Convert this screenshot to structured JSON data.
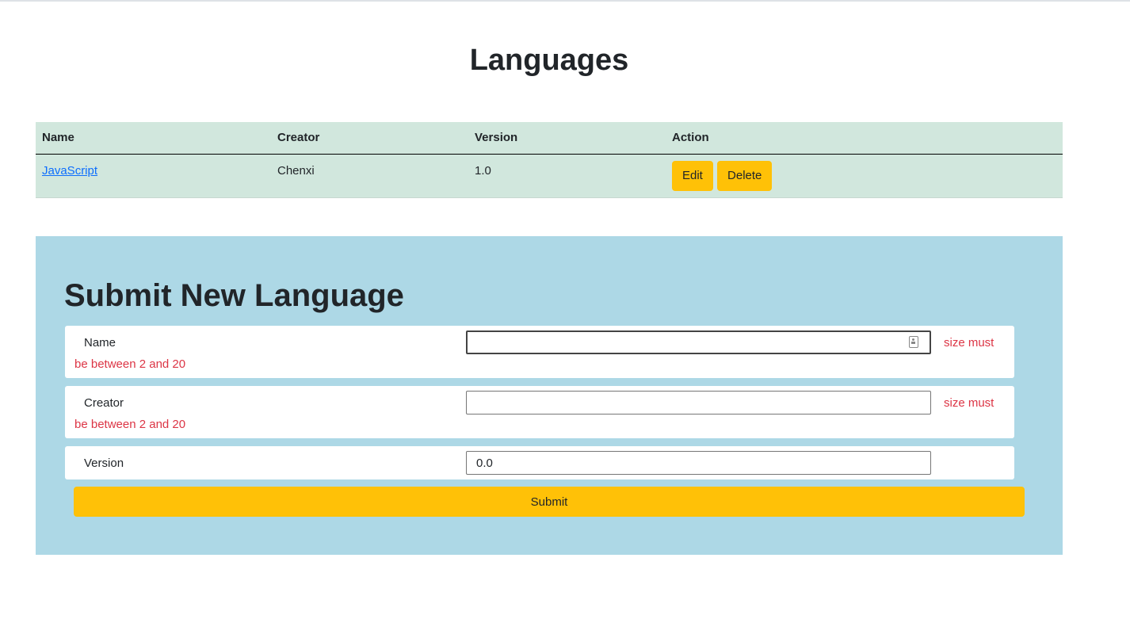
{
  "page": {
    "title": "Languages"
  },
  "table": {
    "headers": [
      "Name",
      "Creator",
      "Version",
      "Action"
    ],
    "rows": [
      {
        "name": "JavaScript",
        "creator": "Chenxi",
        "version": "1.0",
        "edit_label": "Edit",
        "delete_label": "Delete"
      }
    ]
  },
  "form": {
    "title": "Submit New Language",
    "fields": [
      {
        "label": "Name",
        "value": "",
        "error_a": "size must",
        "error_b": "be between 2 and 20"
      },
      {
        "label": "Creator",
        "value": "",
        "error_a": "size must",
        "error_b": "be between 2 and 20"
      },
      {
        "label": "Version",
        "value": "0.0"
      }
    ],
    "submit_label": "Submit"
  },
  "colors": {
    "table_bg": "#d1e7dd",
    "form_bg": "#add8e6",
    "button": "#ffc107",
    "error": "#dc3545",
    "link": "#0d6efd"
  },
  "icons": {
    "name_field": "contact-card-icon"
  }
}
